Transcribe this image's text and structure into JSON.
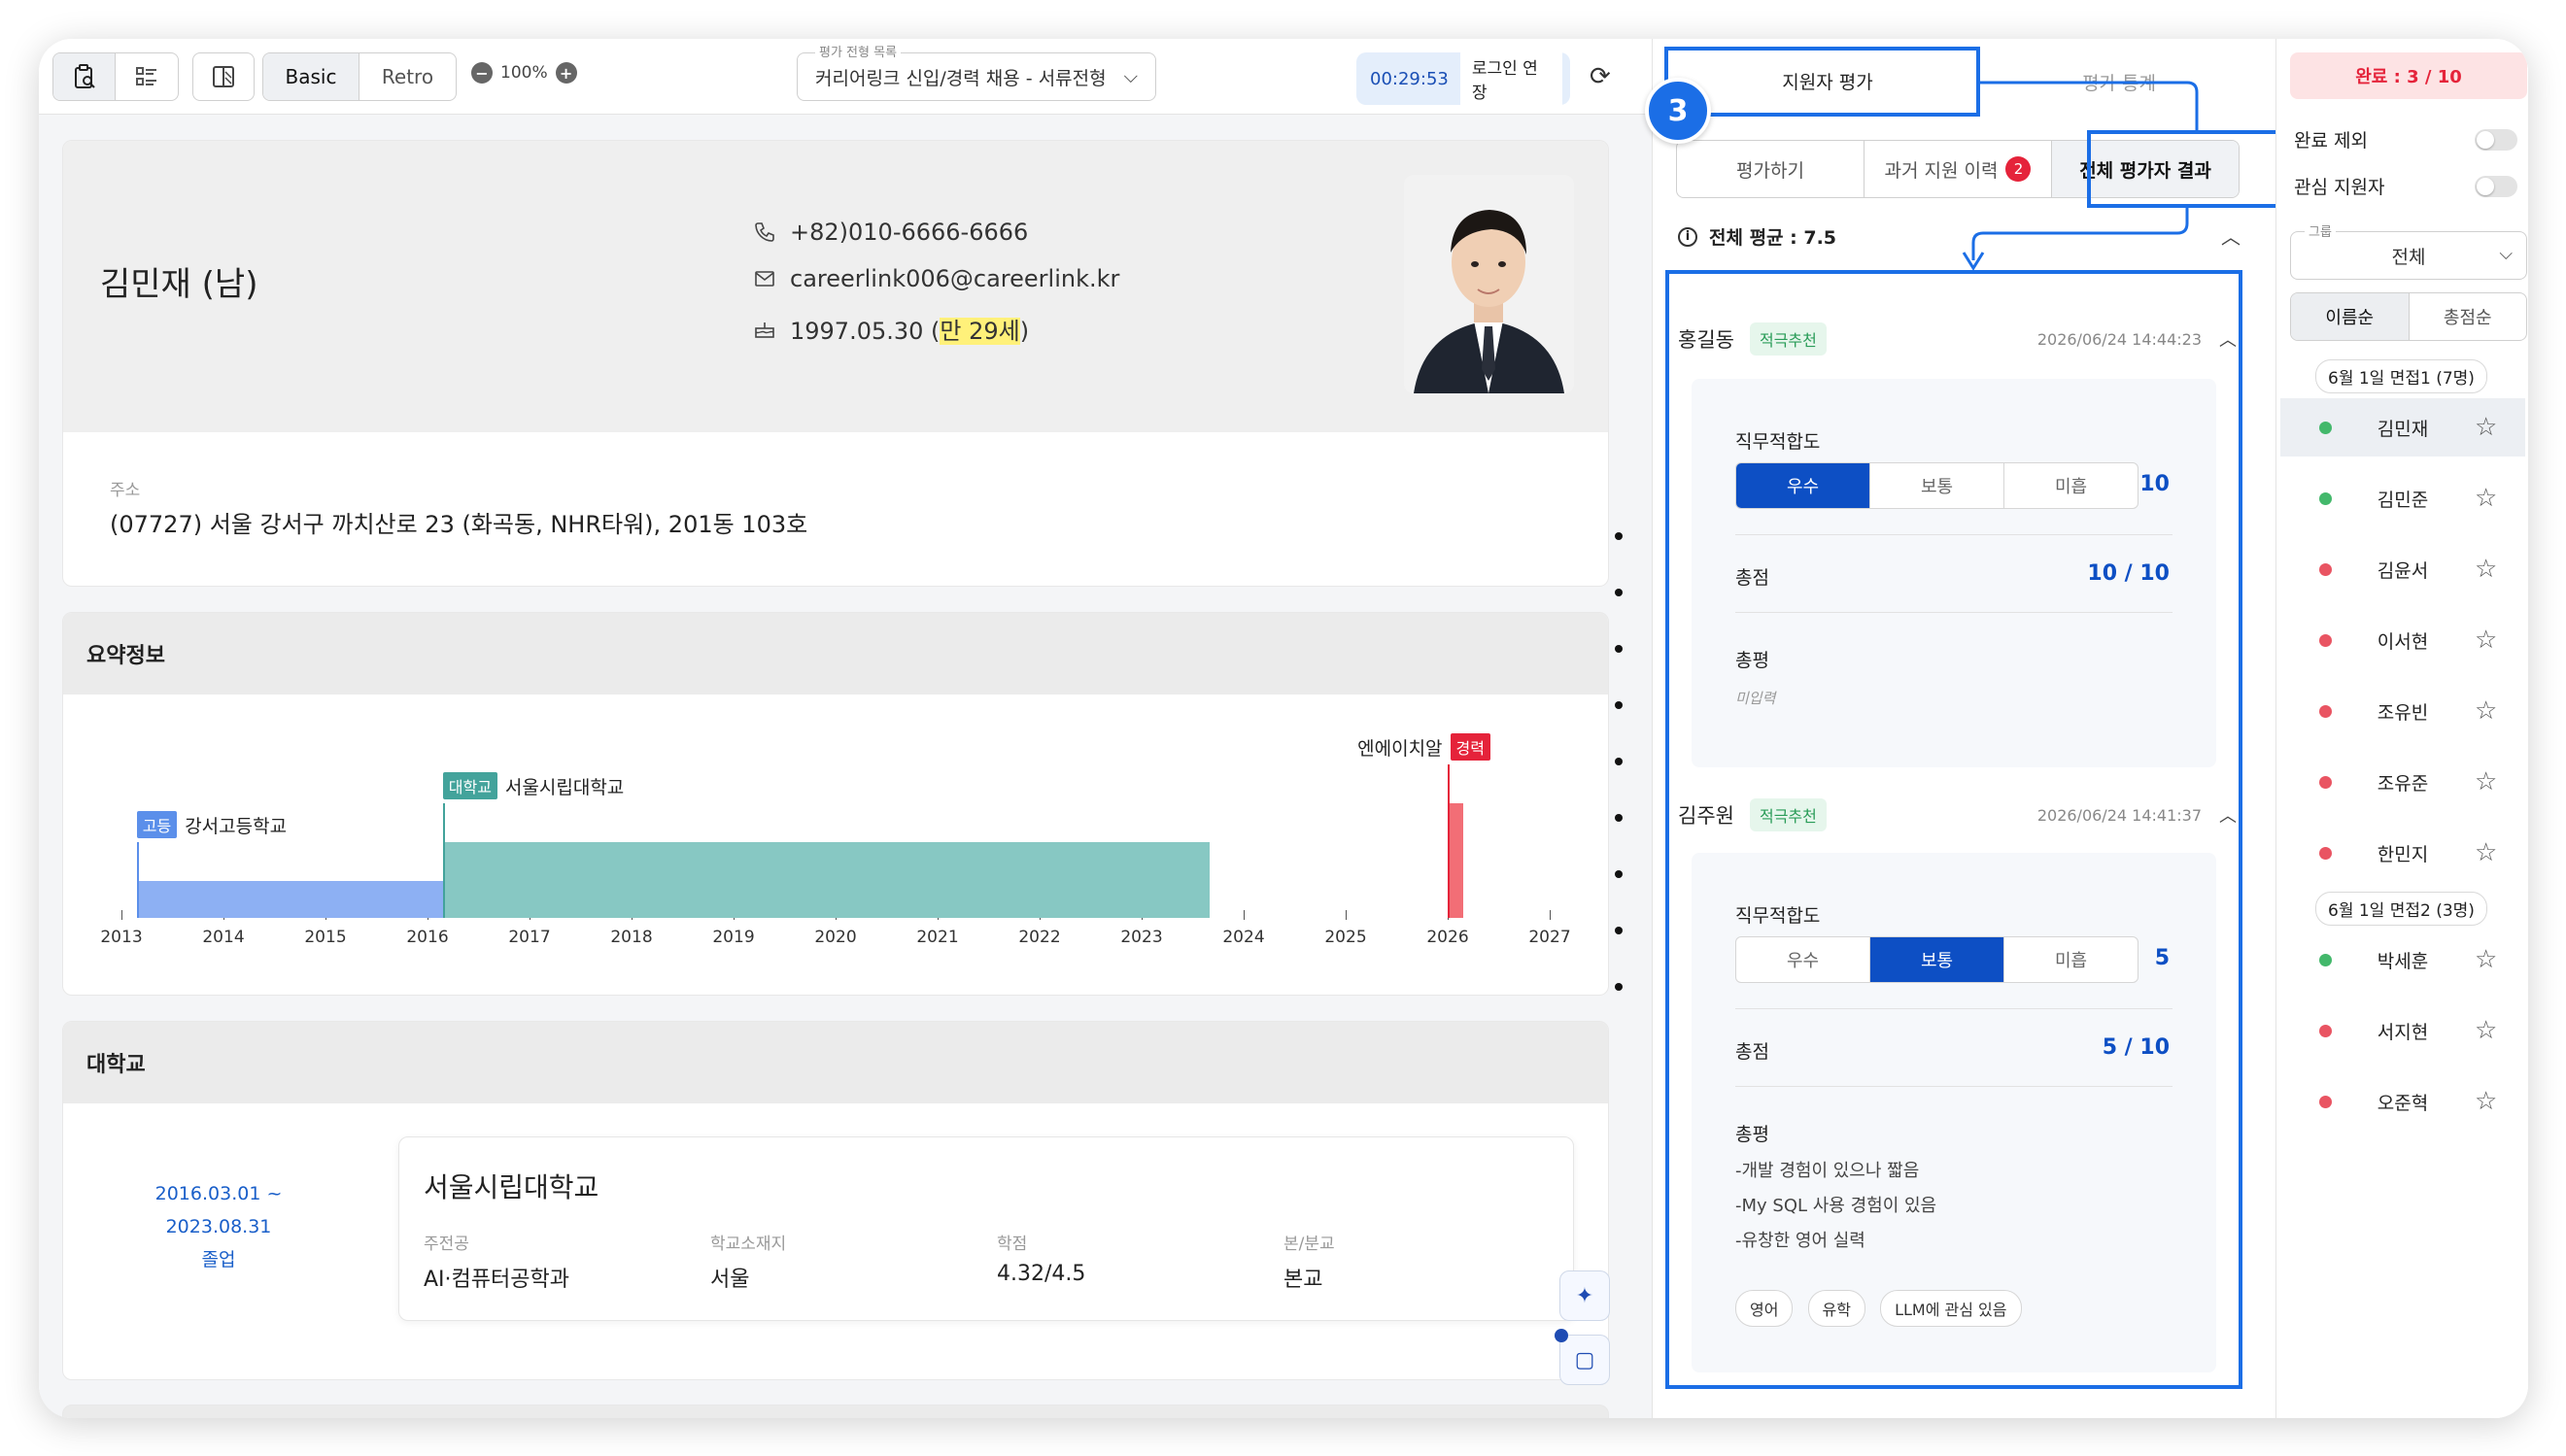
{
  "toolbar": {
    "mode_basic": "Basic",
    "mode_retro": "Retro",
    "zoom": "100%",
    "select_label": "평가 전형 목록",
    "select_value": "커리어링크 신입/경력 채용 - 서류전형",
    "timer": "00:29:53",
    "extend": "로그인 연장"
  },
  "profile": {
    "name": "김민재 (남)",
    "phone": "+82)010-6666-6666",
    "email": "careerlink006@careerlink.kr",
    "birth": "1997.05.30 (",
    "age": "만 29세",
    "birth_close": ")",
    "address_label": "주소",
    "address": "(07727) 서울 강서구 까치산로 23 (화곡동, NHR타워), 201동 103호"
  },
  "summary": {
    "title": "요약정보",
    "years": [
      "2013",
      "2014",
      "2015",
      "2016",
      "2017",
      "2018",
      "2019",
      "2020",
      "2021",
      "2022",
      "2023",
      "2024",
      "2025",
      "2026",
      "2027"
    ],
    "bars": [
      {
        "tag": "고등",
        "name": "강서고등학교",
        "color": "#8db0f3",
        "tag_color": "#5b8fea",
        "start": 2013.15,
        "end": 2016.15
      },
      {
        "tag": "대학교",
        "name": "서울시립대학교",
        "color": "#87c8c3",
        "tag_color": "#43a39b",
        "start": 2016.15,
        "end": 2023.67
      },
      {
        "tag": "경력",
        "name": "엔에이치알",
        "color": "#f26e76",
        "tag_color": "#e5233a",
        "start": 2026.0,
        "end": 2026.15
      }
    ]
  },
  "university": {
    "title": "대학교",
    "period": "2016.03.01 ~ 2023.08.31",
    "status": "졸업",
    "name": "서울시립대학교",
    "fields": [
      {
        "k": "주전공",
        "v": "AI·컴퓨터공학과"
      },
      {
        "k": "학교소재지",
        "v": "서울"
      },
      {
        "k": "학점",
        "v": "4.32/4.5"
      },
      {
        "k": "본/분교",
        "v": "본교"
      }
    ]
  },
  "mid": {
    "tab_eval": "지원자 평가",
    "tab_stats": "평가 통계",
    "badge_num": "3",
    "seg": [
      "평가하기",
      "과거 지원 이력",
      "전체 평가자 결과"
    ],
    "seg_badge": "2",
    "avg": "전체 평균 : 7.5",
    "evaluations": [
      {
        "who": "홍길동",
        "tag": "적극추천",
        "date": "2026/06/24 14:44:23",
        "fit_label": "직무적합도",
        "options": [
          "우수",
          "보통",
          "미흡"
        ],
        "selected": 0,
        "fit_score": "10",
        "total_label": "총점",
        "total": "10 / 10",
        "comment_label": "총평",
        "comment": "미입력",
        "chips": []
      },
      {
        "who": "김주원",
        "tag": "적극추천",
        "date": "2026/06/24 14:41:37",
        "fit_label": "직무적합도",
        "options": [
          "우수",
          "보통",
          "미흡"
        ],
        "selected": 1,
        "fit_score": "5",
        "total_label": "총점",
        "total": "5 / 10",
        "comment_label": "총평",
        "comment_lines": [
          "-개발 경험이 있으나 짧음",
          "-My SQL 사용 경험이 있음",
          "-유창한 영어 실력"
        ],
        "chips": [
          "영어",
          "유학",
          "LLM에 관심 있음"
        ]
      }
    ]
  },
  "right": {
    "done": "완료 : 3 / 10",
    "exclude_done": "완료 제외",
    "interest": "관심 지원자",
    "group_label": "그룹",
    "group_value": "전체",
    "sort": [
      "이름순",
      "총점순"
    ],
    "groups": [
      {
        "title": "6월 1일 면접1 (7명)",
        "members": [
          {
            "name": "김민재",
            "status": "#43b86b",
            "active": true
          },
          {
            "name": "김민준",
            "status": "#43b86b"
          },
          {
            "name": "김윤서",
            "status": "#e95462"
          },
          {
            "name": "이서현",
            "status": "#e95462"
          },
          {
            "name": "조유빈",
            "status": "#e95462"
          },
          {
            "name": "조유준",
            "status": "#e95462"
          },
          {
            "name": "한민지",
            "status": "#e95462"
          }
        ]
      },
      {
        "title": "6월 1일 면접2 (3명)",
        "members": [
          {
            "name": "박세훈",
            "status": "#43b86b"
          },
          {
            "name": "서지현",
            "status": "#e95462"
          },
          {
            "name": "오준혁",
            "status": "#e95462"
          }
        ]
      }
    ]
  }
}
